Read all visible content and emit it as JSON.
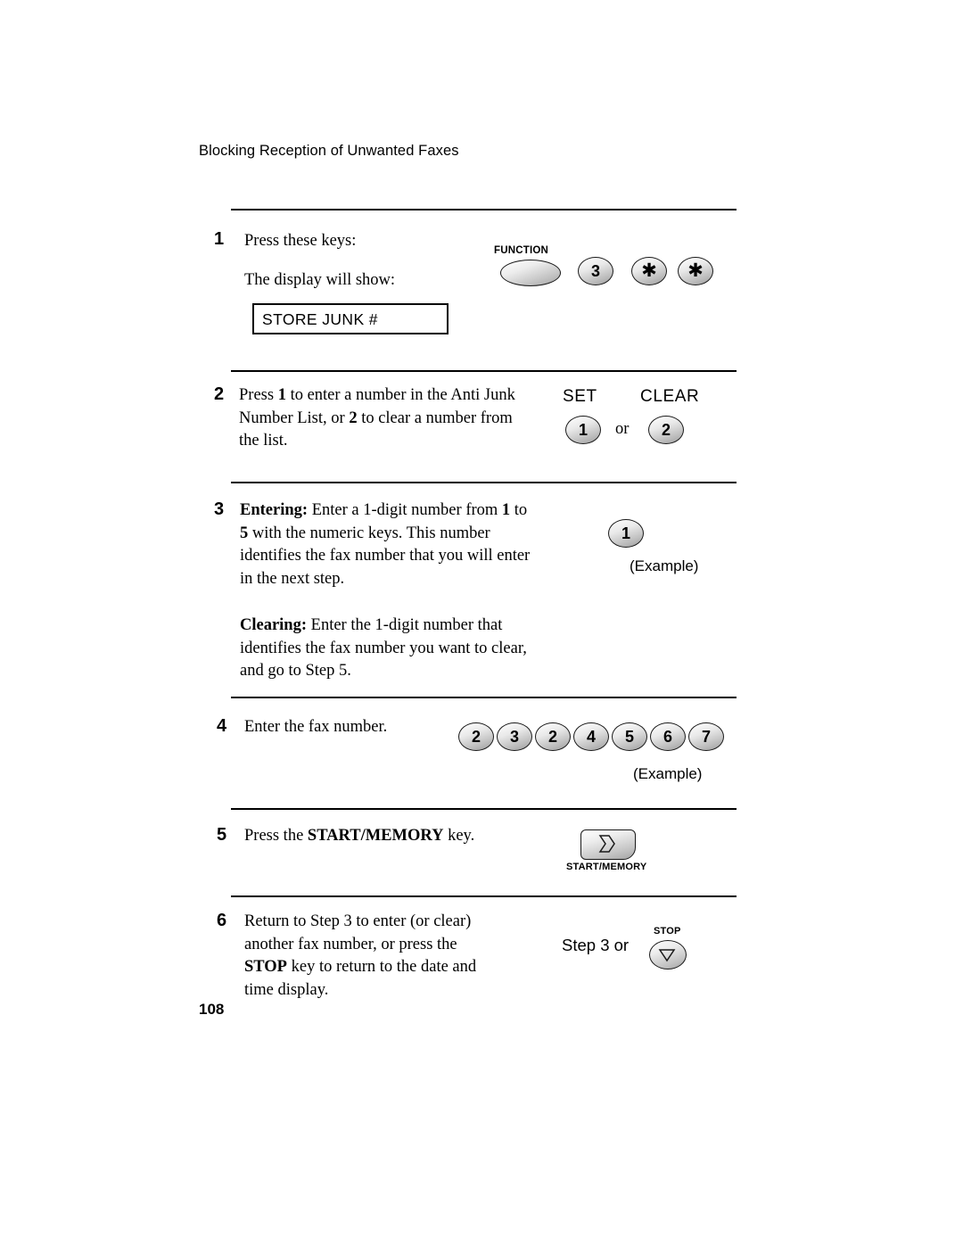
{
  "document": {
    "header": "Blocking Reception of Unwanted Faxes",
    "page_number": "108"
  },
  "lcd": {
    "text": "STORE JUNK #"
  },
  "steps": [
    {
      "number": "1",
      "line1": "Press these keys:",
      "line2": "The display will show:",
      "keys": {
        "function_label": "FUNCTION",
        "digit": "3",
        "asterisk1": "asterisk",
        "asterisk2": "asterisk"
      }
    },
    {
      "number": "2",
      "text_parts": {
        "a": " Press ",
        "b": "1",
        "c": " to enter a number in the Anti",
        "d": "Junk Number List, or ",
        "e": "2",
        "f": " to clear a",
        "g": "number from the list."
      },
      "keys": {
        "set_label": "SET",
        "clear_label": "CLEAR",
        "set_key": "1",
        "or": "or",
        "clear_key": "2"
      }
    },
    {
      "number": "3",
      "entering_label": "Entering:",
      "entering_text_1": " Enter a 1-digit number",
      "entering_text_2": "from ",
      "entering_bold_1": "1",
      "entering_text_3": " to ",
      "entering_bold_2": "5",
      "entering_text_4": " with the numeric keys.",
      "entering_text_5": "This number identifies the fax",
      "entering_text_6": "number that you will enter in the next",
      "entering_text_7": "step.",
      "clearing_label": "Clearing:",
      "clearing_text_1": " Enter the 1-digit number",
      "clearing_text_2": "that identifies the fax number you",
      "clearing_text_3": "want to clear, and go to Step 5.",
      "key": "1",
      "example": "(Example)"
    },
    {
      "number": "4",
      "text": "Enter the fax number.",
      "keys": [
        "2",
        "3",
        "2",
        "4",
        "5",
        "6",
        "7"
      ],
      "example": "(Example)"
    },
    {
      "number": "5",
      "text_1": "Press the ",
      "text_bold": "START/MEMORY",
      "text_2": " key.",
      "key_label": "START/MEMORY"
    },
    {
      "number": "6",
      "line1": "Return to Step 3 to enter (or clear)",
      "line2": "another fax number, or press the",
      "line3_bold": "STOP",
      "line3_rest": " key to return to the date and",
      "line4": "time display.",
      "step_text": "Step 3 or",
      "key_label": "STOP"
    }
  ]
}
